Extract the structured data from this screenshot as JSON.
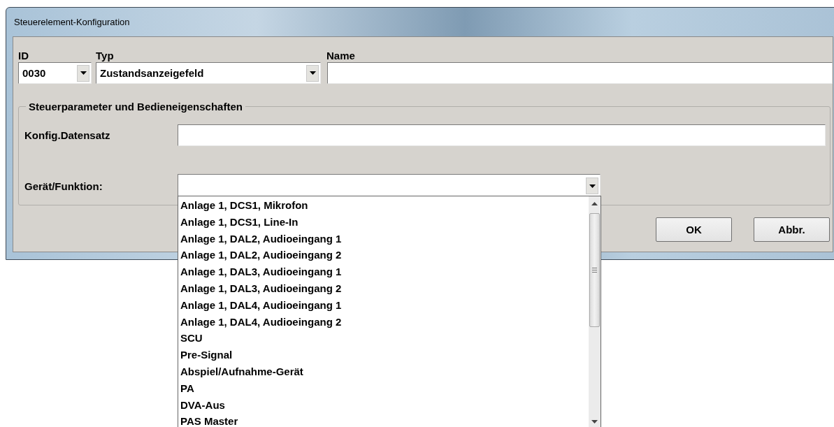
{
  "window": {
    "title": "Steuerelement-Konfiguration"
  },
  "header": {
    "id_label": "ID",
    "id_value": "0030",
    "type_label": "Typ",
    "type_value": "Zustandsanzeigefeld",
    "name_label": "Name"
  },
  "group": {
    "legend": "Steuerparameter und Bedieneigenschaften",
    "config_label": "Konfig.Datensatz",
    "device_label": "Gerät/Funktion:",
    "device_open": true,
    "device_options": [
      {
        "label": "Anlage 1, DCS1, Mikrofon",
        "selected": false
      },
      {
        "label": "Anlage 1, DCS1, Line-In",
        "selected": false
      },
      {
        "label": "Anlage 1, DAL2, Audioeingang 1",
        "selected": false
      },
      {
        "label": "Anlage 1, DAL2, Audioeingang 2",
        "selected": false
      },
      {
        "label": "Anlage 1, DAL3, Audioeingang 1",
        "selected": false
      },
      {
        "label": "Anlage 1, DAL3, Audioeingang 2",
        "selected": false
      },
      {
        "label": "Anlage 1, DAL4, Audioeingang 1",
        "selected": false
      },
      {
        "label": "Anlage 1, DAL4, Audioeingang 2",
        "selected": false
      },
      {
        "label": "SCU",
        "selected": false
      },
      {
        "label": "Pre-Signal",
        "selected": false
      },
      {
        "label": "Abspiel/Aufnahme-Gerät",
        "selected": false
      },
      {
        "label": "PA",
        "selected": false
      },
      {
        "label": "DVA-Aus",
        "selected": false
      },
      {
        "label": "PAS Master",
        "selected": false
      }
    ]
  },
  "buttons": [
    "OK",
    "Abbr."
  ]
}
